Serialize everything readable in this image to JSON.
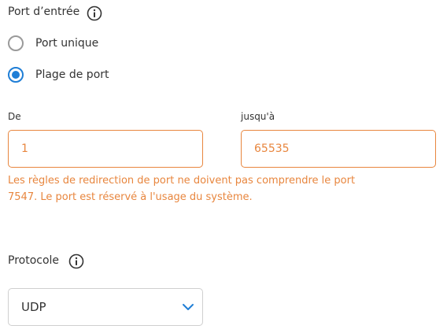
{
  "input_port": {
    "label": "Port d’entrée",
    "info_icon": "info-icon",
    "options": [
      {
        "label": "Port unique",
        "selected": false
      },
      {
        "label": "Plage de port",
        "selected": true
      }
    ]
  },
  "range": {
    "from_label": "De",
    "from_value": "1",
    "to_label": "jusqu'à",
    "to_value": "65535",
    "error_line1": "Les règles de redirection de port ne doivent pas comprendre le port",
    "error_line2": "7547. Le port est réservé à l'usage du système."
  },
  "protocol": {
    "label": "Protocole",
    "info_icon": "info-icon",
    "selected": "UDP",
    "chevron_icon": "chevron-down-icon"
  },
  "colors": {
    "text": "#333333",
    "accent_blue": "#1f7ed6",
    "error_orange": "#e8863e",
    "border_gray": "#cfcfcf"
  }
}
